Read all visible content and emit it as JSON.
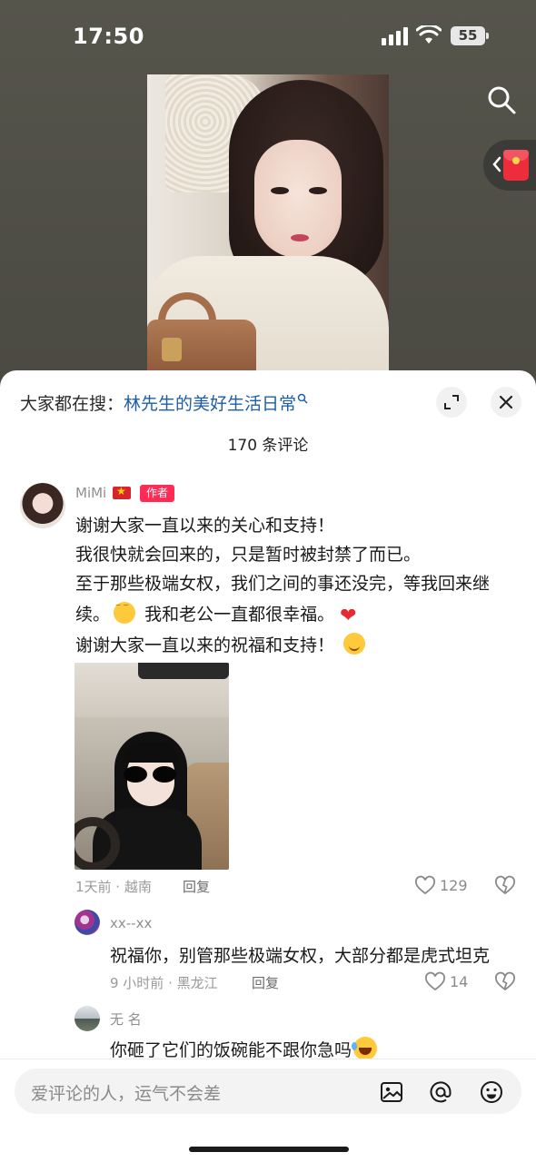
{
  "status_bar": {
    "time": "17:50",
    "battery": "55"
  },
  "hot_search": {
    "prefix": "大家都在搜：",
    "query": "林先生的美好生活日常"
  },
  "comments_header": {
    "count_label": "170 条评论"
  },
  "main_comment": {
    "username": "MiMi",
    "author_badge": "作者",
    "lines": [
      "谢谢大家一直以来的关心和支持！",
      "我很快就会回来的，只是暂时被封禁了而已。",
      "至于那些极端女权，我们之间的事还没完，等我回来继",
      "续。",
      "我和老公一直都很幸福。",
      "谢谢大家一直以来的祝福和支持！"
    ],
    "meta": "1天前 · 越南",
    "reply_label": "回复",
    "likes": "129"
  },
  "replies": [
    {
      "username": "xx--xx",
      "text": "祝福你，别管那些极端女权，大部分都是虎式坦克",
      "meta": "9 小时前 · 黑龙江",
      "reply_label": "回复",
      "likes": "14"
    },
    {
      "username": "无 名",
      "text": "你砸了它们的饭碗能不跟你急吗"
    }
  ],
  "input": {
    "placeholder": "爱评论的人，运气不会差"
  },
  "colors": {
    "accent_red": "#fe2c55",
    "link_blue": "#1c5ea8",
    "sheet_bg": "#ffffff"
  },
  "icons": [
    "search-icon",
    "red-packet-icon",
    "expand-icon",
    "close-icon",
    "heart-icon",
    "dislike-icon",
    "image-icon",
    "mention-icon",
    "emoji-icon"
  ]
}
